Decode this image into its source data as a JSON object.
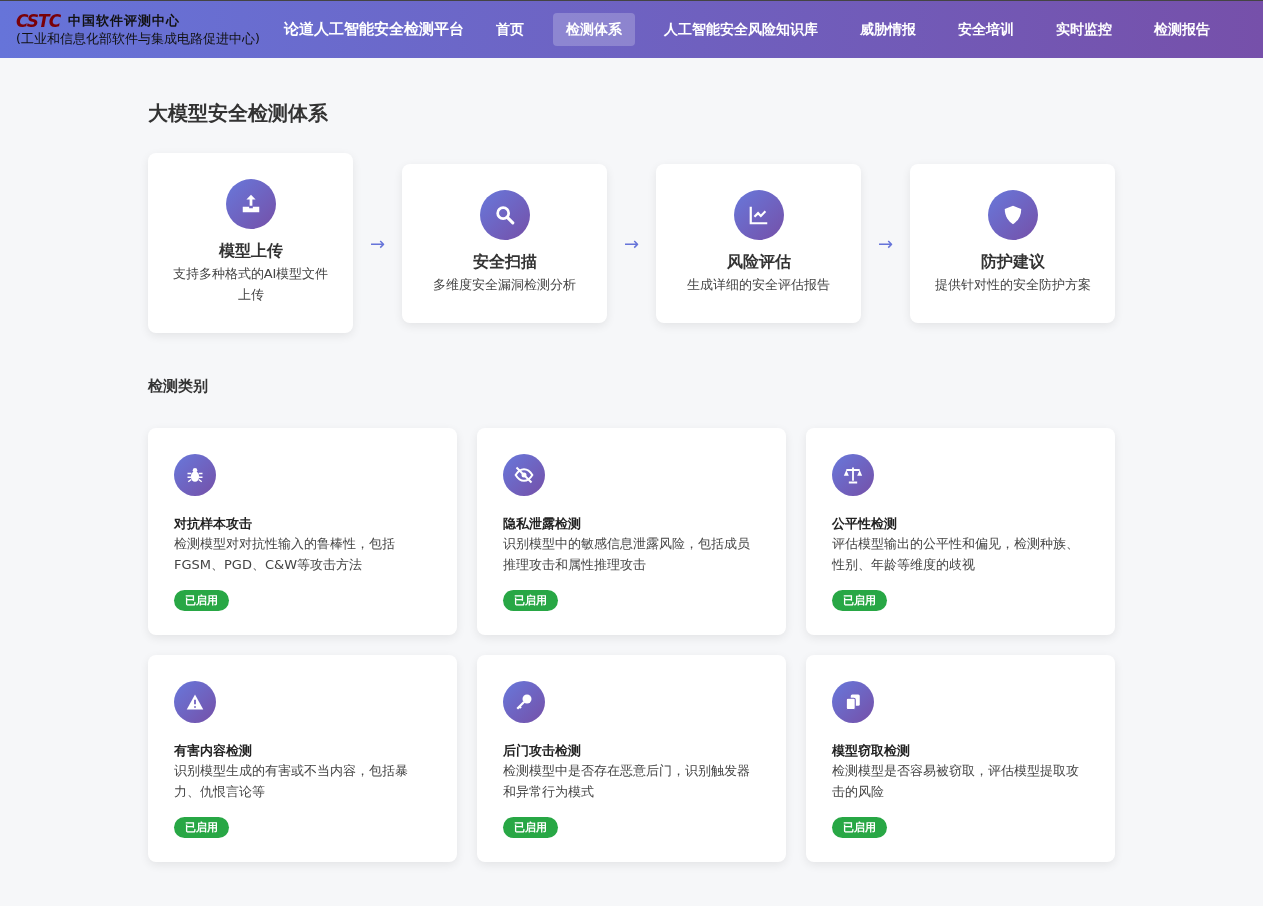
{
  "header": {
    "logo_text": "CSTC",
    "org_name": "中国软件评测中心",
    "org_sub": "(工业和信息化部软件与集成电路促进中心)",
    "platform": "论道人工智能安全检测平台",
    "nav": [
      {
        "label": "首页",
        "selected": false
      },
      {
        "label": "检测体系",
        "selected": true
      },
      {
        "label": "人工智能安全风险知识库",
        "selected": false
      },
      {
        "label": "威胁情报",
        "selected": false
      },
      {
        "label": "安全培训",
        "selected": false
      },
      {
        "label": "实时监控",
        "selected": false
      },
      {
        "label": "检测报告",
        "selected": false
      }
    ]
  },
  "page_title": "大模型安全检测体系",
  "steps": [
    {
      "title": "模型上传",
      "desc": "支持多种格式的AI模型文件上传"
    },
    {
      "title": "安全扫描",
      "desc": "多维度安全漏洞检测分析"
    },
    {
      "title": "风险评估",
      "desc": "生成详细的安全评估报告"
    },
    {
      "title": "防护建议",
      "desc": "提供针对性的安全防护方案"
    }
  ],
  "arrow": "→",
  "categories_title": "检测类别",
  "categories": [
    {
      "title": "对抗样本攻击",
      "desc": "检测模型对对抗性输入的鲁棒性，包括FGSM、PGD、C&W等攻击方法",
      "status": "已启用",
      "enabled": true
    },
    {
      "title": "隐私泄露检测",
      "desc": "识别模型中的敏感信息泄露风险，包括成员推理攻击和属性推理攻击",
      "status": "已启用",
      "enabled": true
    },
    {
      "title": "公平性检测",
      "desc": "评估模型输出的公平性和偏见，检测种族、性别、年龄等维度的歧视",
      "status": "已启用",
      "enabled": true
    },
    {
      "title": "有害内容检测",
      "desc": "识别模型生成的有害或不当内容，包括暴力、仇恨言论等",
      "status": "已启用",
      "enabled": true
    },
    {
      "title": "后门攻击检测",
      "desc": "检测模型中是否存在恶意后门，识别触发器和异常行为模式",
      "status": "已启用",
      "enabled": true
    },
    {
      "title": "模型窃取检测",
      "desc": "检测模型是否容易被窃取，评估模型提取攻击的风险",
      "status": "已启用",
      "enabled": true
    }
  ]
}
